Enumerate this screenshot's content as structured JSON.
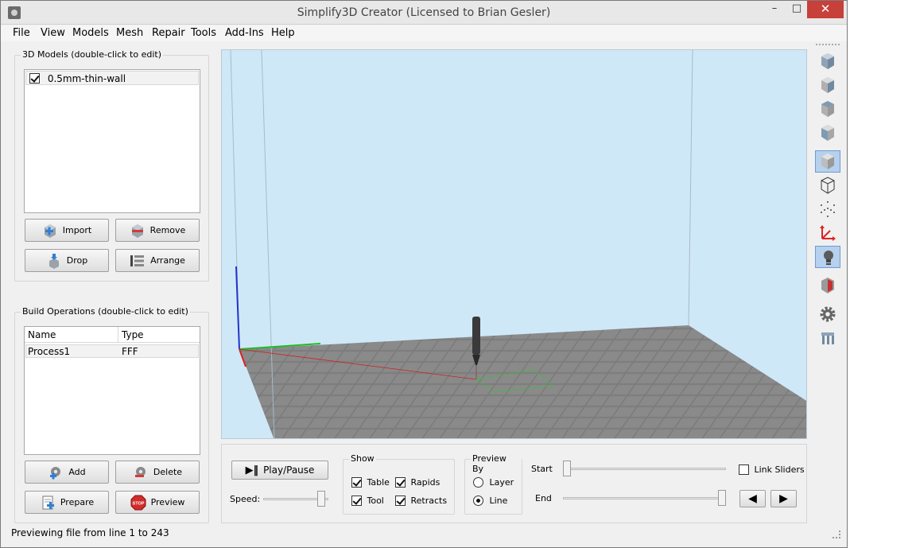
{
  "window": {
    "title": "Simplify3D Creator (Licensed to Brian Gesler)",
    "buttons": {
      "minimize": "–",
      "maximize": "□",
      "close": "✕"
    }
  },
  "menu": [
    "File",
    "View",
    "Models",
    "Mesh",
    "Repair",
    "Tools",
    "Add-Ins",
    "Help"
  ],
  "models_panel": {
    "label": "3D Models (double-click to edit)",
    "items": [
      {
        "name": "0.5mm-thin-wall",
        "checked": true
      }
    ],
    "buttons": {
      "import": "Import",
      "remove": "Remove",
      "drop": "Drop",
      "arrange": "Arrange"
    }
  },
  "build_panel": {
    "label": "Build Operations (double-click to edit)",
    "columns": [
      "Name",
      "Type"
    ],
    "rows": [
      {
        "name": "Process1",
        "type": "FFF"
      }
    ],
    "buttons": {
      "add": "Add",
      "delete": "Delete",
      "prepare": "Prepare",
      "preview": "Preview"
    }
  },
  "controls": {
    "play_pause": "Play/Pause",
    "speed_label": "Speed:",
    "speed_fraction": 0.95,
    "show_group": {
      "label": "Show",
      "table": "Table",
      "tool": "Tool",
      "rapids": "Rapids",
      "retracts": "Retracts"
    },
    "preview_by": {
      "label": "Preview By",
      "layer": "Layer",
      "line": "Line",
      "selected": "Line"
    },
    "start_label": "Start",
    "end_label": "End",
    "start_fraction": 0.0,
    "end_fraction": 1.0,
    "link_sliders": "Link Sliders"
  },
  "status": {
    "text": "Previewing file from line 1 to 243"
  },
  "colors": {
    "close_button": "#c7403a",
    "viewport_sky": "#cfe8f8",
    "bed": "#7c7c7c",
    "active_tool": "#b6d1ee"
  },
  "toolbar_icons": [
    "view-default-icon",
    "view-front-icon",
    "view-top-icon",
    "view-side-icon",
    "solid-mode-icon",
    "wireframe-mode-icon",
    "point-mode-icon",
    "axes-icon",
    "lighting-icon",
    "cross-section-icon",
    "settings-gear-icon",
    "bed-machine-icon"
  ]
}
